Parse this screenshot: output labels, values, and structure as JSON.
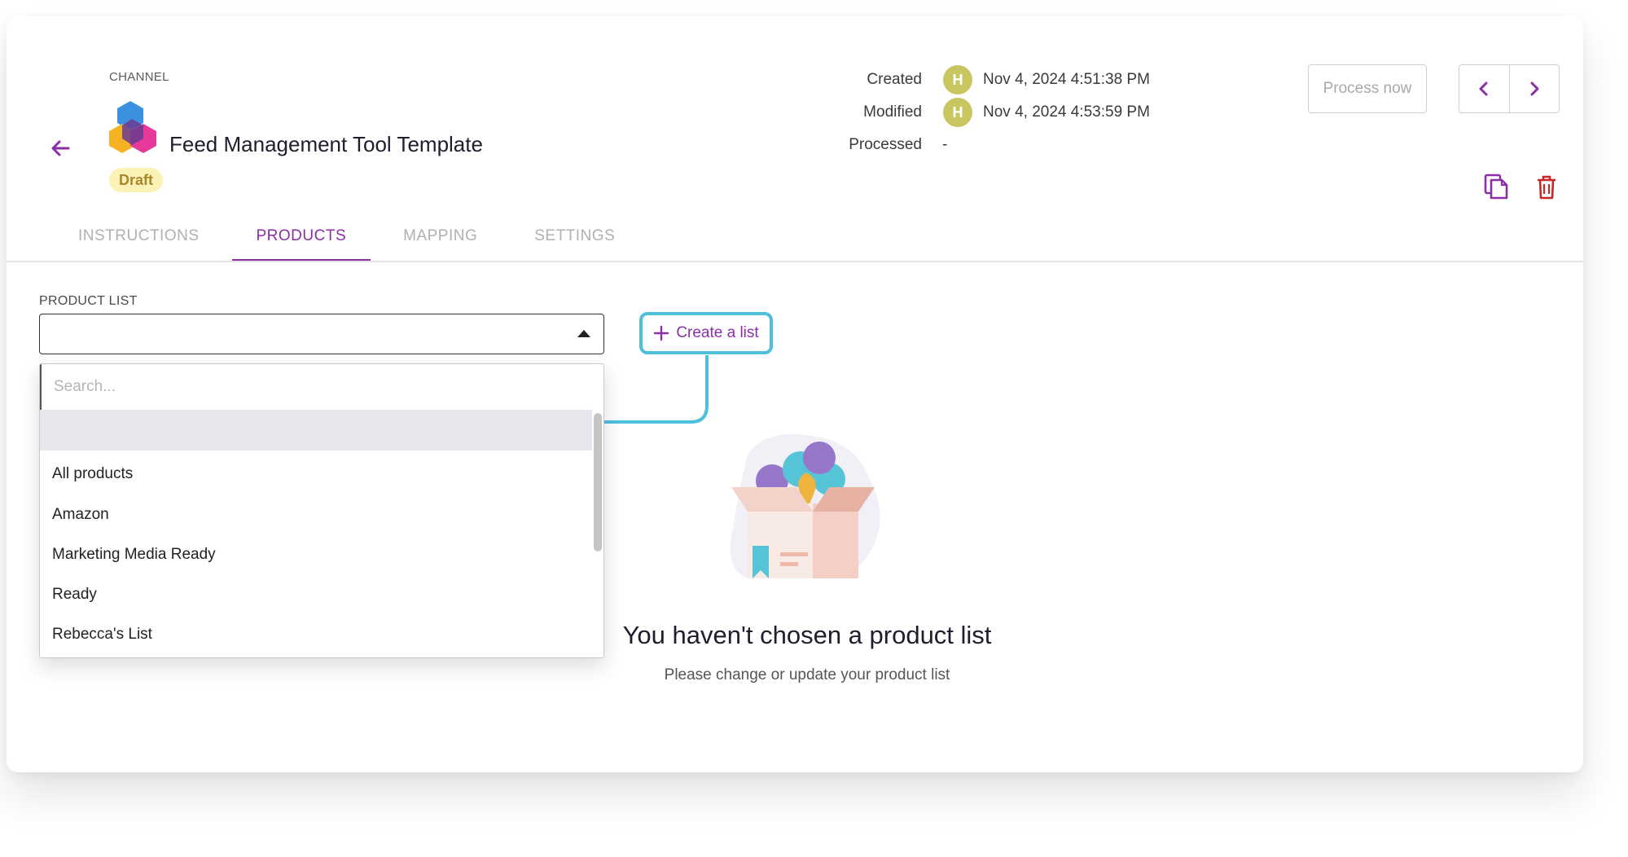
{
  "header": {
    "channel_label": "CHANNEL",
    "title": "Feed Management Tool Template",
    "status_badge": "Draft",
    "meta": {
      "created_label": "Created",
      "created_value": "Nov 4, 2024 4:51:38 PM",
      "modified_label": "Modified",
      "modified_value": "Nov 4, 2024 4:53:59 PM",
      "processed_label": "Processed",
      "processed_value": "-",
      "avatar_initial": "H"
    },
    "process_button": "Process now",
    "icons": [
      "back-arrow-icon",
      "chevron-left-icon",
      "chevron-right-icon",
      "copy-icon",
      "trash-icon"
    ]
  },
  "tabs": [
    {
      "label": "INSTRUCTIONS",
      "active": false
    },
    {
      "label": "PRODUCTS",
      "active": true
    },
    {
      "label": "MAPPING",
      "active": false
    },
    {
      "label": "SETTINGS",
      "active": false
    }
  ],
  "product_list": {
    "label": "PRODUCT LIST",
    "selected": "",
    "search_placeholder": "Search...",
    "options": [
      "All products",
      "Amazon",
      "Marketing Media Ready",
      "Ready",
      "Rebecca's List"
    ]
  },
  "create_button": "Create a list",
  "empty_state": {
    "title": "You haven't chosen a product list",
    "subtitle": "Please change or update your product list"
  },
  "colors": {
    "accent": "#8a2fa6",
    "highlight_outline": "#4fc0dc",
    "badge_bg": "#fbf2b6",
    "avatar": "#c8c65f",
    "danger": "#c62828"
  }
}
